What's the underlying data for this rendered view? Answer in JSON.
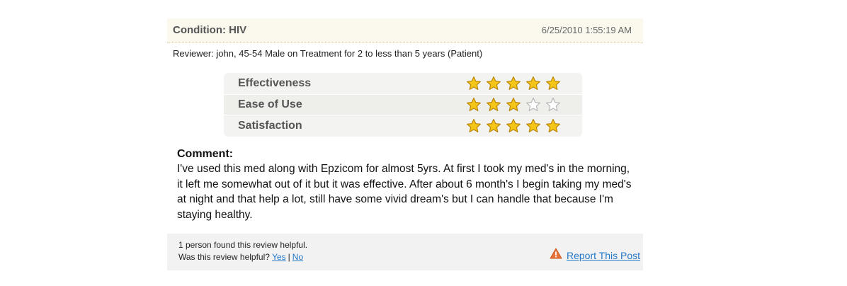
{
  "header": {
    "condition": "Condition: HIV",
    "date": "6/25/2010 1:55:19 AM"
  },
  "reviewer": "Reviewer: john, 45-54 Male on Treatment for 2 to less than 5 years (Patient)",
  "ratings": [
    {
      "label": "Effectiveness",
      "stars": 5,
      "max": 5
    },
    {
      "label": "Ease of Use",
      "stars": 3,
      "max": 5
    },
    {
      "label": "Satisfaction",
      "stars": 5,
      "max": 5
    }
  ],
  "comment": {
    "heading": "Comment:",
    "body": "I've used this med along with Epzicom for almost 5yrs. At first I took my med's in the morning, it left me somewhat out of it but it was effective. After about 6 month's I begin taking my med's at night and that help a lot, still have some vivid dream's but I can handle that because I'm staying healthy."
  },
  "footer": {
    "helpful_count": "1 person found this review helpful.",
    "helpful_question": "Was this review helpful?",
    "yes_label": "Yes",
    "separator": "|",
    "no_label": "No",
    "report_label": "Report This Post"
  },
  "colors": {
    "star_filled": "#f5c518",
    "star_empty": "#ffffff",
    "link": "#2479c9",
    "warning": "#e8733a"
  },
  "icons": {
    "star_filled": "star-icon",
    "star_empty": "star-outline-icon",
    "report": "warning-icon"
  }
}
